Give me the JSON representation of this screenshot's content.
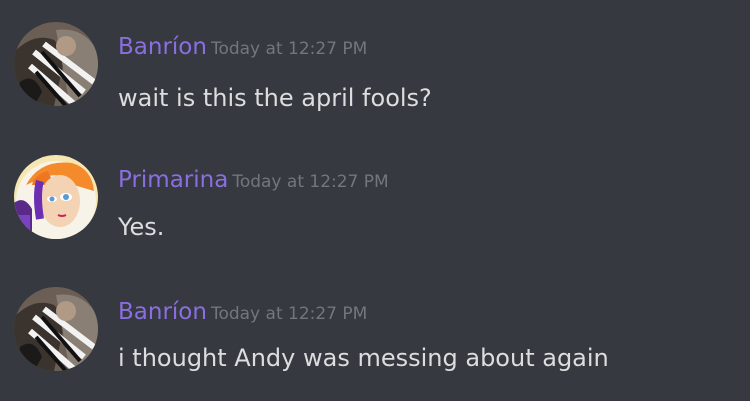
{
  "messages": [
    {
      "author": "Banríon",
      "timestamp": "Today at 12:27 PM",
      "text": "wait is this the april fools?",
      "avatar_icon": "user-avatar-banrion"
    },
    {
      "author": "Primarina",
      "timestamp": "Today at 12:27 PM",
      "text": "Yes.",
      "avatar_icon": "user-avatar-primarina"
    },
    {
      "author": "Banríon",
      "timestamp": "Today at 12:27 PM",
      "text": "i thought Andy was messing about again",
      "avatar_icon": "user-avatar-banrion"
    }
  ],
  "colors": {
    "background": "#36393f",
    "username": "#8b6ee0",
    "timestamp": "#72767d",
    "message_text": "#dcddde"
  }
}
